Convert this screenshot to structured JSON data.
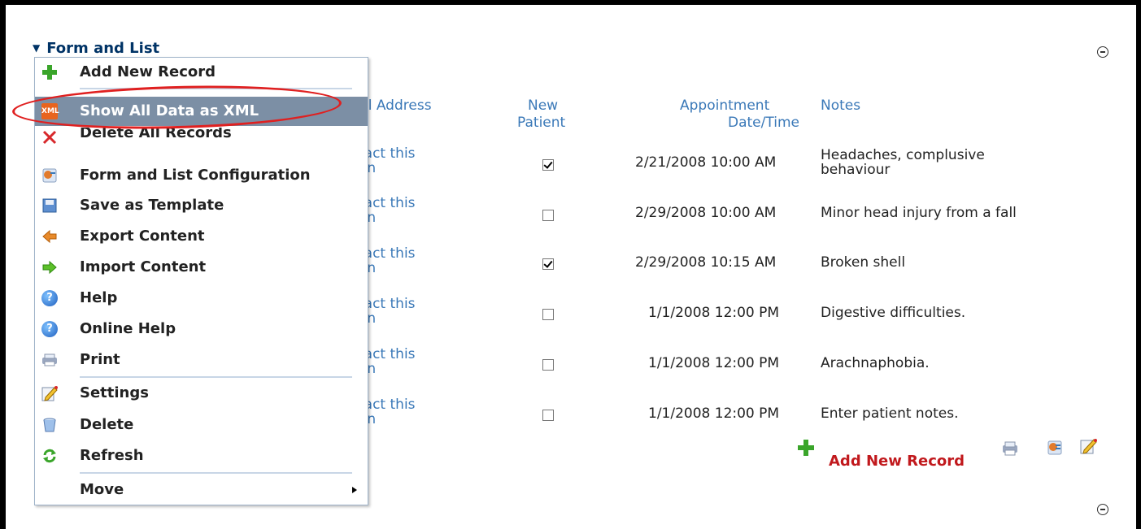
{
  "module": {
    "title": "Form and List",
    "add_record_label": "Add New Record"
  },
  "table": {
    "headers": {
      "email": "il Address",
      "new_patient_1": "New",
      "new_patient_2": "Patient",
      "appt_1": "Appointment",
      "appt_2": "Date/Time",
      "notes": "Notes"
    },
    "rows": [
      {
        "contact_1": "tact this",
        "contact_2": "on",
        "new_patient": true,
        "datetime": "2/21/2008 10:00 AM",
        "notes_1": "Headaches, complusive",
        "notes_2": "behaviour"
      },
      {
        "contact_1": "tact this",
        "contact_2": "on",
        "new_patient": false,
        "datetime": "2/29/2008 10:00 AM",
        "notes_1": "Minor head injury from a fall",
        "notes_2": ""
      },
      {
        "contact_1": "tact this",
        "contact_2": "on",
        "new_patient": true,
        "datetime": "2/29/2008 10:15 AM",
        "notes_1": "Broken shell",
        "notes_2": ""
      },
      {
        "contact_1": "tact this",
        "contact_2": "on",
        "new_patient": false,
        "datetime": "1/1/2008 12:00 PM",
        "notes_1": "Digestive difficulties.",
        "notes_2": ""
      },
      {
        "contact_1": "tact this",
        "contact_2": "on",
        "new_patient": false,
        "datetime": "1/1/2008 12:00 PM",
        "notes_1": "Arachnaphobia.",
        "notes_2": ""
      },
      {
        "contact_1": "tact this",
        "contact_2": "on",
        "new_patient": false,
        "datetime": "1/1/2008 12:00 PM",
        "notes_1": "Enter patient notes.",
        "notes_2": ""
      }
    ]
  },
  "menu": {
    "items": [
      {
        "label": "Add New Record",
        "icon": "plus-icon"
      },
      {
        "label": "Show All Data as XML",
        "icon": "xml-icon",
        "selected": true
      },
      {
        "label": "Delete All Records",
        "icon": "delete-x-icon"
      },
      {
        "label": "Form and List Configuration",
        "icon": "configuration-icon"
      },
      {
        "label": "Save as Template",
        "icon": "save-template-icon"
      },
      {
        "label": "Export Content",
        "icon": "export-arrow-icon"
      },
      {
        "label": "Import Content",
        "icon": "import-arrow-icon"
      },
      {
        "label": "Help",
        "icon": "help-icon"
      },
      {
        "label": "Online Help",
        "icon": "online-help-icon"
      },
      {
        "label": "Print",
        "icon": "print-icon"
      },
      {
        "label": "Settings",
        "icon": "settings-pencil-icon"
      },
      {
        "label": "Delete",
        "icon": "trash-icon"
      },
      {
        "label": "Refresh",
        "icon": "refresh-icon"
      },
      {
        "label": "Move",
        "icon": "submenu-arrow-icon"
      }
    ]
  },
  "icons": {
    "xml_text": "XML",
    "help_text": "?"
  },
  "colors": {
    "link_blue": "#3b79b8",
    "accent_red": "#c1191d",
    "selected_bg": "#7c8fa5",
    "annotation_red": "#e02020"
  }
}
